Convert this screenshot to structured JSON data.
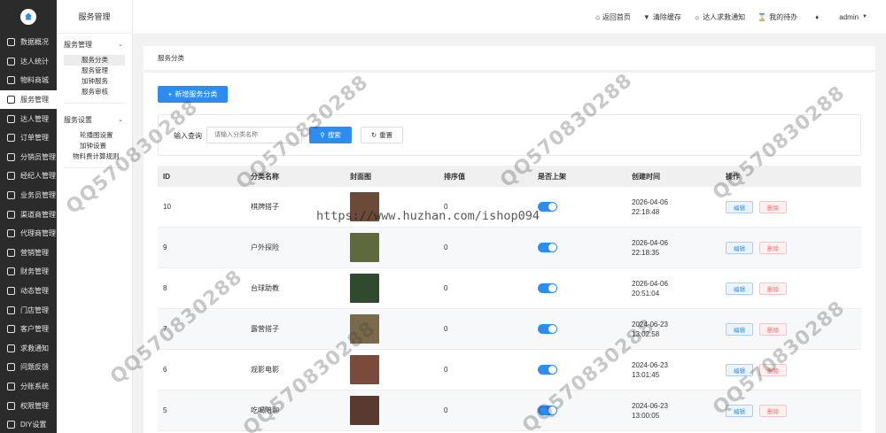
{
  "nav": {
    "items": [
      {
        "label": "数据概况",
        "icon": "dashboard-icon"
      },
      {
        "label": "达人统计",
        "icon": "chart-icon"
      },
      {
        "label": "物料商城",
        "icon": "shop-icon"
      },
      {
        "label": "服务管理",
        "icon": "service-icon",
        "active": true
      },
      {
        "label": "达人管理",
        "icon": "user-icon"
      },
      {
        "label": "订单管理",
        "icon": "order-icon"
      },
      {
        "label": "分销员管理",
        "icon": "distributor-icon"
      },
      {
        "label": "经纪人管理",
        "icon": "agent-icon"
      },
      {
        "label": "业务员管理",
        "icon": "salesman-icon"
      },
      {
        "label": "渠道商管理",
        "icon": "channel-icon"
      },
      {
        "label": "代理商管理",
        "icon": "proxy-icon"
      },
      {
        "label": "营销管理",
        "icon": "marketing-icon"
      },
      {
        "label": "财务管理",
        "icon": "finance-icon"
      },
      {
        "label": "动态管理",
        "icon": "moment-icon"
      },
      {
        "label": "门店管理",
        "icon": "store-icon"
      },
      {
        "label": "客户管理",
        "icon": "customer-icon"
      },
      {
        "label": "求救通知",
        "icon": "alert-icon"
      },
      {
        "label": "问题反馈",
        "icon": "feedback-icon"
      },
      {
        "label": "分账系统",
        "icon": "split-icon"
      },
      {
        "label": "权限管理",
        "icon": "permission-icon"
      },
      {
        "label": "DIY设置",
        "icon": "diy-icon"
      }
    ]
  },
  "submenu": {
    "title": "服务管理",
    "group1": "服务管理",
    "group1_items": [
      "服务分类",
      "服务管理",
      "加钟服务",
      "服务审核"
    ],
    "group2": "服务设置",
    "group2_items": [
      "轮播图设置",
      "加钟设置",
      "物料费计算规则"
    ]
  },
  "topbar": {
    "home": "返回首页",
    "clear_cache": "清除缓存",
    "sos": "达人求救通知",
    "todo": "我的待办",
    "user": "admin"
  },
  "breadcrumb": "服务分类",
  "toolbar": {
    "add_label": "新增服务分类"
  },
  "search": {
    "label": "输入查询",
    "placeholder": "请输入分类名称",
    "search_label": "搜索",
    "reset_label": "重置"
  },
  "table": {
    "headers": [
      "ID",
      "分类名称",
      "封面图",
      "排序值",
      "是否上架",
      "创建时间",
      "操作"
    ],
    "edit_label": "编辑",
    "delete_label": "删除",
    "rows": [
      {
        "id": "10",
        "name": "棋牌搭子",
        "sort": "0",
        "date": "2026-04-06",
        "time": "22:18:48",
        "cover": "#6b4a3a"
      },
      {
        "id": "9",
        "name": "户外探险",
        "sort": "0",
        "date": "2026-04-06",
        "time": "22:18:35",
        "cover": "#5e6a3b"
      },
      {
        "id": "8",
        "name": "台球助教",
        "sort": "0",
        "date": "2026-04-06",
        "time": "20:51:04",
        "cover": "#2f4a2c"
      },
      {
        "id": "7",
        "name": "露营搭子",
        "sort": "0",
        "date": "2024-06-23",
        "time": "13:02:58",
        "cover": "#7a6a4a"
      },
      {
        "id": "6",
        "name": "观影电影",
        "sort": "0",
        "date": "2024-06-23",
        "time": "13:01:45",
        "cover": "#7a4a3a"
      },
      {
        "id": "5",
        "name": "吃喝陪聊",
        "sort": "0",
        "date": "2024-06-23",
        "time": "13:00:05",
        "cover": "#5a3a30"
      }
    ]
  },
  "watermark": {
    "qq": "QQ570830288",
    "url": "https://www.huzhan.com/ishop094"
  }
}
